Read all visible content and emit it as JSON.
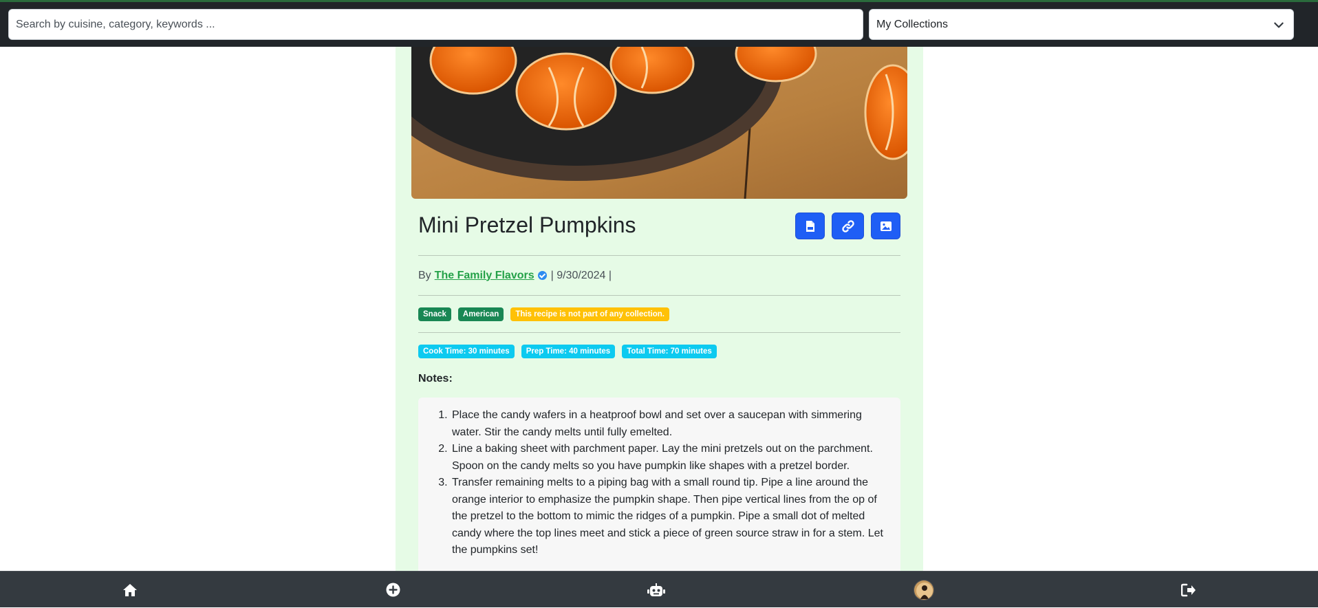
{
  "search": {
    "placeholder": "Search by cuisine, category, keywords ..."
  },
  "collections": {
    "selected": "My Collections"
  },
  "recipe": {
    "title": "Mini Pretzel Pumpkins",
    "by_label": "By",
    "author": "The Family Flavors",
    "date_text": "| 9/30/2024 |",
    "tags": [
      "Snack",
      "American"
    ],
    "collection_notice": "This recipe is not part of any collection.",
    "cook_time": "Cook Time: 30 minutes",
    "prep_time": "Prep Time: 40 minutes",
    "total_time": "Total Time: 70 minutes",
    "notes_label": "Notes:",
    "steps": [
      "Place the candy wafers in a heatproof bowl and set over a saucepan with simmering water. Stir the candy melts until fully emelted.",
      "Line a baking sheet with parchment paper. Lay the mini pretzels out on the parchment. Spoon on the candy melts so you have pumpkin like shapes with a pretzel border.",
      "Transfer remaining melts to a piping bag with a small round tip. Pipe a line around the orange interior to emphasize the pumpkin shape. Then pipe vertical lines from the op of the pretzel to the bottom to mimic the ridges of a pumpkin. Pipe a small dot of melted candy where the top lines meet and stick a piece of green source straw in for a stem. Let the pumpkins set!"
    ]
  },
  "icons": {
    "pdf": "file-pdf-icon",
    "link": "link-icon",
    "image": "image-icon",
    "home": "home-icon",
    "add": "plus-circle-icon",
    "robot": "robot-icon",
    "logout": "logout-icon"
  },
  "colors": {
    "accent_blue": "#1f5ef5",
    "page_green": "#e6fbe6",
    "author_green": "#24a148",
    "badge_green": "#198754",
    "badge_warning": "#ffc107",
    "badge_info": "#0dcaf0",
    "nav_bg": "#343a40"
  }
}
